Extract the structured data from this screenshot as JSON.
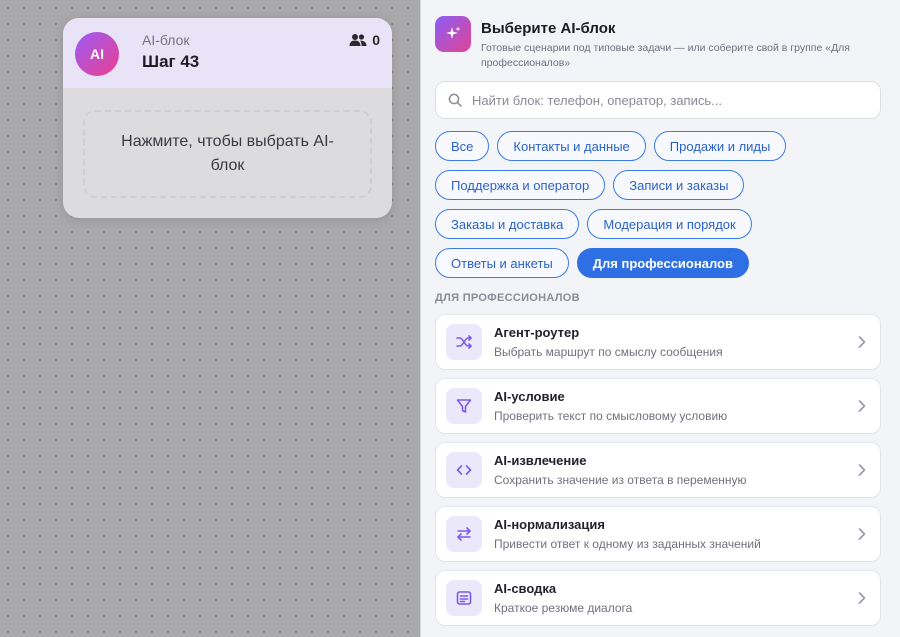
{
  "node": {
    "avatar": "AI",
    "subtitle": "AI-блок",
    "title": "Шаг 43",
    "users_count": "0",
    "placeholder": "Нажмите, чтобы выбрать AI-блок"
  },
  "panel": {
    "title": "Выберите AI-блок",
    "description": "Готовые сценарии под типовые задачи — или соберите свой в группе «Для профессионалов»",
    "search_placeholder": "Найти блок: телефон, оператор, запись...",
    "chips": [
      {
        "label": "Все"
      },
      {
        "label": "Контакты и данные"
      },
      {
        "label": "Продажи и лиды"
      },
      {
        "label": "Поддержка и оператор"
      },
      {
        "label": "Записи и заказы"
      },
      {
        "label": "Заказы и доставка"
      },
      {
        "label": "Модерация и порядок"
      },
      {
        "label": "Ответы и анкеты"
      },
      {
        "label": "Для профессионалов",
        "active": true
      }
    ],
    "section_label": "ДЛЯ ПРОФЕССИОНАЛОВ",
    "items": [
      {
        "title": "Агент-роутер",
        "desc": "Выбрать маршрут по смыслу сообщения",
        "icon": "shuffle-icon"
      },
      {
        "title": "AI-условие",
        "desc": "Проверить текст по смысловому условию",
        "icon": "filter-icon"
      },
      {
        "title": "AI-извлечение",
        "desc": "Сохранить значение из ответа в переменную",
        "icon": "code-icon"
      },
      {
        "title": "AI-нормализация",
        "desc": "Привести ответ к одному из заданных значений",
        "icon": "swap-arrows-icon"
      },
      {
        "title": "AI-сводка",
        "desc": "Краткое резюме диалога",
        "icon": "summary-icon"
      }
    ]
  },
  "colors": {
    "accent": "#2e6fe3",
    "icon_tint": "#8b6cf0",
    "gradient_start": "#9b5cf6",
    "gradient_end": "#ec3f8f"
  }
}
